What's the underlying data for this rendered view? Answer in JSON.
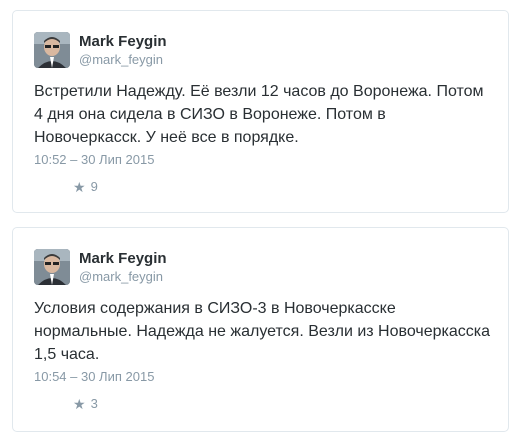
{
  "tweets": [
    {
      "author_name": "Mark Feygin",
      "author_handle": "@mark_feygin",
      "avatar_icon": "avatar-icon",
      "text_lines": [
        "Встретили Надежду. Её везли 12 часов до Воронежа. Потом",
        "4 дня она сидела в СИЗО в Воронеже. Потом в",
        "Новочеркасск. У неё все в порядке."
      ],
      "timestamp": "10:52 – 30 Лип 2015",
      "favorite_icon": "star-icon",
      "favorite_count": "9"
    },
    {
      "author_name": "Mark Feygin",
      "author_handle": "@mark_feygin",
      "avatar_icon": "avatar-icon",
      "text_lines": [
        "Условия содержания в СИЗО-3 в Новочеркасске",
        "нормальные. Надежда не жалуется. Везли из Новочеркасска",
        "1,5 часа."
      ],
      "timestamp": "10:54 – 30 Лип 2015",
      "favorite_icon": "star-icon",
      "favorite_count": "3"
    }
  ],
  "colors": {
    "name": "#292f33",
    "secondary": "#8899a6",
    "border": "#e1e8ed"
  }
}
